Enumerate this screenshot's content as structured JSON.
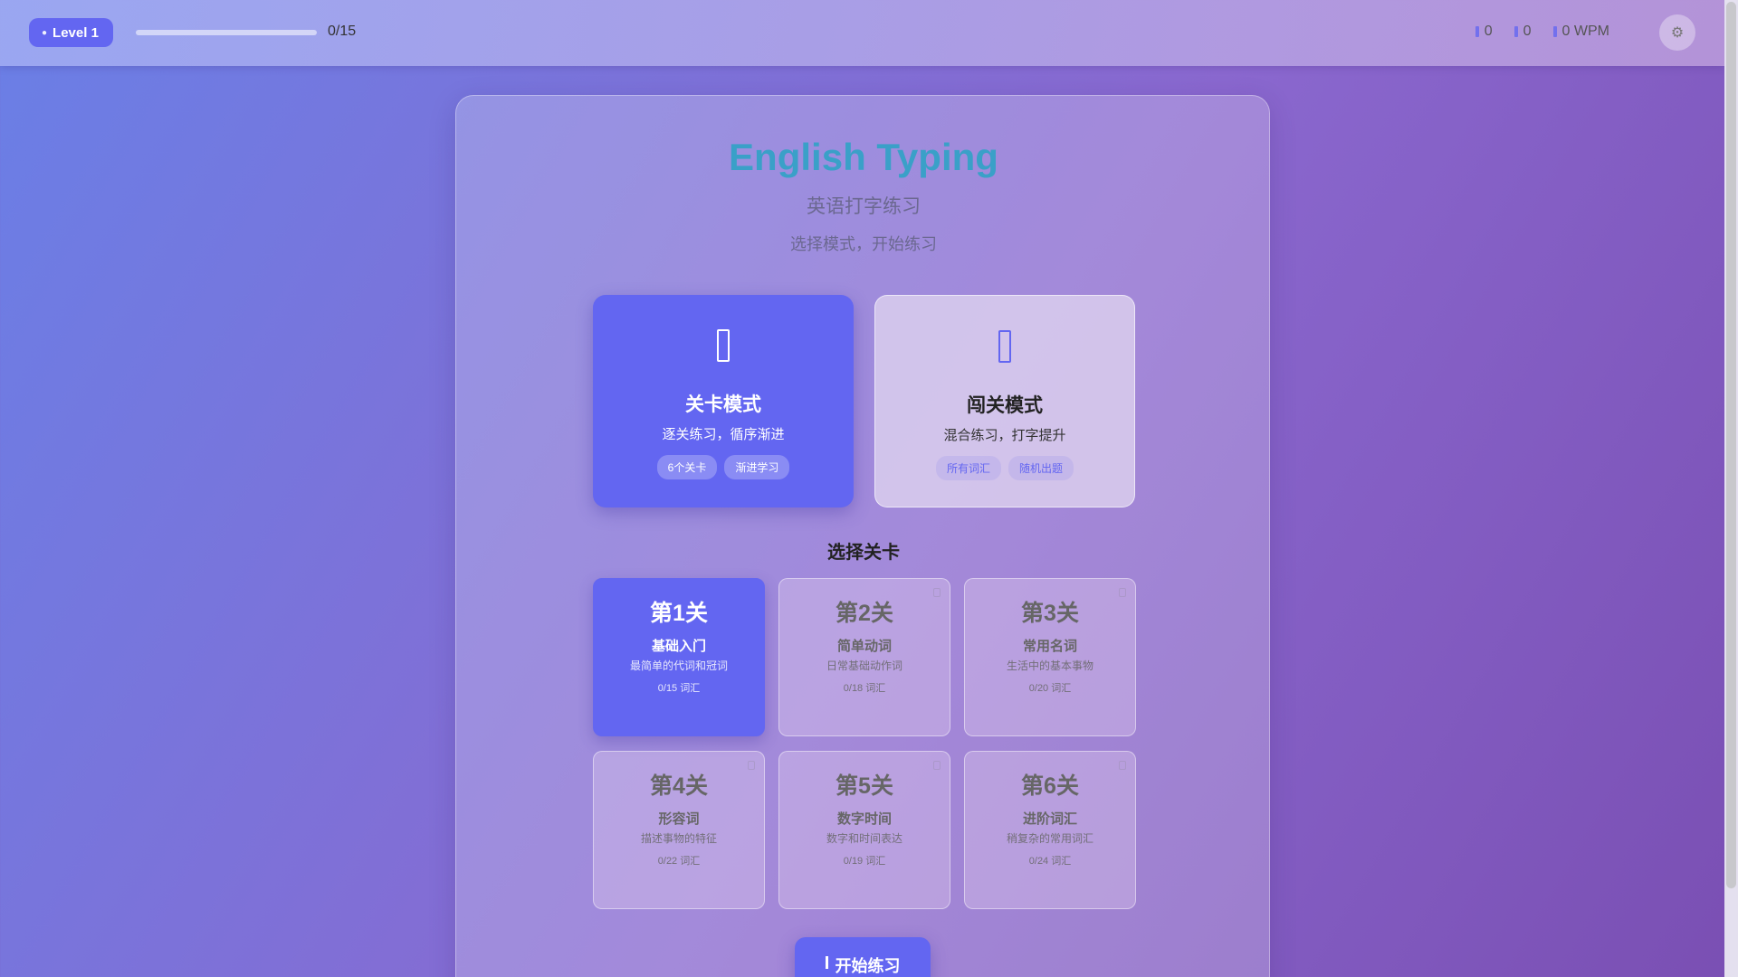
{
  "header": {
    "level_badge": "Level 1",
    "progress_text": "0/15",
    "progress_fraction": 0,
    "stats": [
      {
        "icon": "star-icon",
        "value": "0"
      },
      {
        "icon": "flame-icon",
        "value": "0"
      },
      {
        "icon": "speed-icon",
        "value": "0 WPM"
      }
    ],
    "settings_icon": "gear-icon"
  },
  "main": {
    "title": "English Typing",
    "subtitle": "英语打字练习",
    "hint": "选择模式，开始练习",
    "modes": [
      {
        "title": "关卡模式",
        "desc": "逐关练习，循序渐进",
        "tags": [
          "6个关卡",
          "渐进学习"
        ],
        "active": true
      },
      {
        "title": "闯关模式",
        "desc": "混合练习，打字提升",
        "tags": [
          "所有词汇",
          "随机出题"
        ],
        "active": false
      }
    ],
    "section_title": "选择关卡",
    "levels": [
      {
        "num": "第1关",
        "name": "基础入门",
        "desc": "最简单的代词和冠词",
        "count": "0/15 词汇"
      },
      {
        "num": "第2关",
        "name": "简单动词",
        "desc": "日常基础动作词",
        "count": "0/18 词汇"
      },
      {
        "num": "第3关",
        "name": "常用名词",
        "desc": "生活中的基本事物",
        "count": "0/20 词汇"
      },
      {
        "num": "第4关",
        "name": "形容词",
        "desc": "描述事物的特征",
        "count": "0/22 词汇"
      },
      {
        "num": "第5关",
        "name": "数字时间",
        "desc": "数字和时间表达",
        "count": "0/19 词汇"
      },
      {
        "num": "第6关",
        "name": "进阶词汇",
        "desc": "稍复杂的常用词汇",
        "count": "0/24 词汇"
      }
    ],
    "start_label": "开始练习"
  },
  "colors": {
    "accent": "#6366f1",
    "title": "#3aa0c8"
  }
}
